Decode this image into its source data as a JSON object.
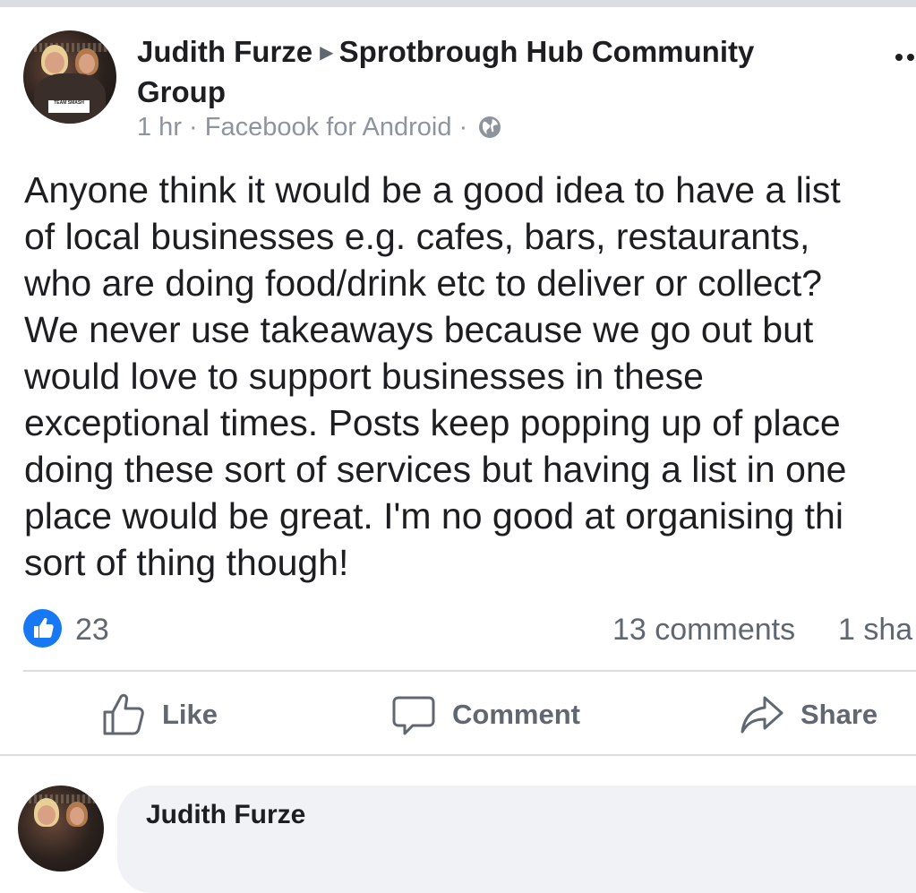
{
  "post": {
    "author": "Judith Furze",
    "group": "Sprotbrough Hub Community Group",
    "group_line1": "Sprotbrough Hub Community",
    "group_line2": "Group",
    "time": "1 hr",
    "separator": "·",
    "source": "Facebook for Android",
    "privacy_icon": "globe-icon",
    "avatar_sign_text": "TEAM SMASH",
    "lines": [
      "Anyone think it would be a good idea to have a list",
      "of local businesses e.g. cafes, bars, restaurants,",
      "who are doing food/drink etc to deliver or collect?",
      "We never use takeaways because we go out but",
      "would love to support businesses in these",
      "exceptional times. Posts keep popping up of place",
      "doing these sort of services but having a list in one",
      "place would be great. I'm no good at organising thi",
      "sort of thing though!"
    ]
  },
  "reactions": {
    "like_count": "23",
    "comments": "13 comments",
    "shares": "1 sha"
  },
  "actions": {
    "like": "Like",
    "comment": "Comment",
    "share": "Share"
  },
  "comment": {
    "author": "Judith Furze"
  },
  "colors": {
    "brand_blue": "#1877f2",
    "secondary_text": "#606770",
    "meta_text": "#8d949e",
    "divider": "#dadde1",
    "bubble": "#f0f2f5"
  }
}
